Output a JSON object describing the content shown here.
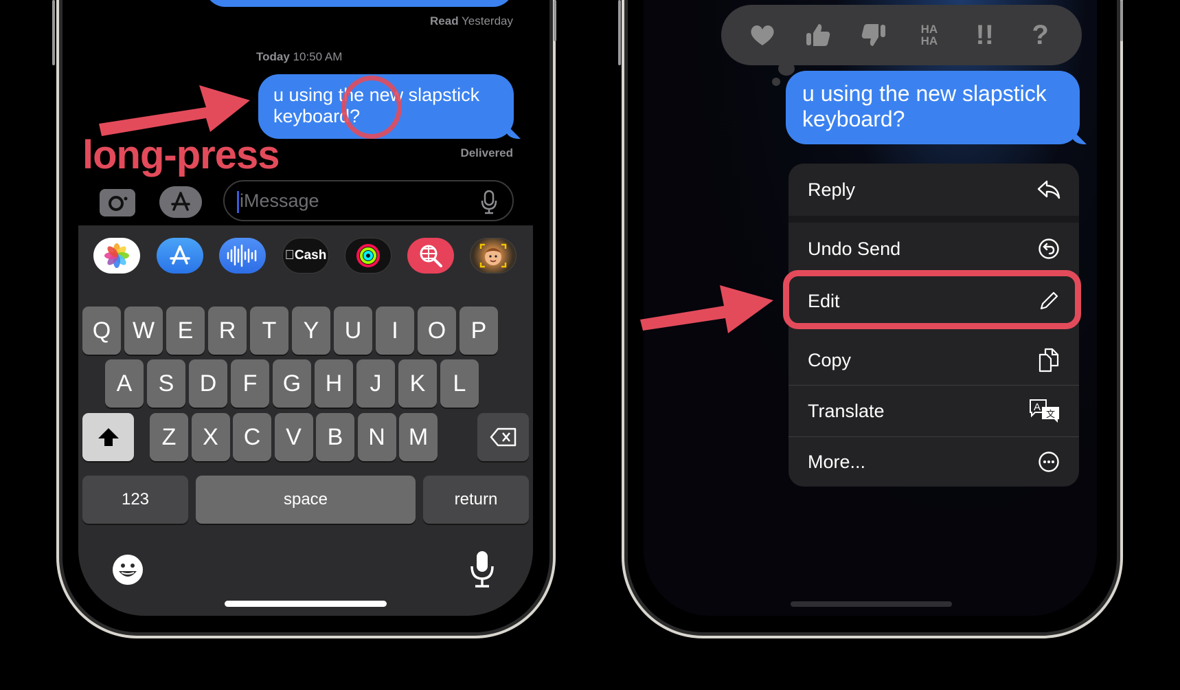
{
  "left_phone": {
    "previous_status": {
      "read_label": "Read",
      "read_time": "Yesterday"
    },
    "timestamp": {
      "day": "Today",
      "time": "10:50 AM"
    },
    "message": {
      "text": "u using the new slapstick keyboard?"
    },
    "delivery_status": "Delivered",
    "annotation": {
      "label": "long-press"
    },
    "composer": {
      "camera_icon": "camera-icon",
      "apps_icon": "app-store-icon",
      "placeholder": "iMessage",
      "mic_icon": "microphone-icon"
    },
    "app_drawer": [
      {
        "name": "Photos",
        "icon": "photos-icon"
      },
      {
        "name": "App Store",
        "icon": "app-store-icon"
      },
      {
        "name": "Audio Message",
        "icon": "waveform-icon"
      },
      {
        "name": "Cash",
        "label": "Cash",
        "icon": "apple-cash-icon"
      },
      {
        "name": "Activity",
        "icon": "activity-rings-icon"
      },
      {
        "name": "Images Search",
        "icon": "globe-search-icon"
      },
      {
        "name": "Memoji",
        "icon": "memoji-icon"
      }
    ],
    "keyboard": {
      "row1": [
        "Q",
        "W",
        "E",
        "R",
        "T",
        "Y",
        "U",
        "I",
        "O",
        "P"
      ],
      "row2": [
        "A",
        "S",
        "D",
        "F",
        "G",
        "H",
        "J",
        "K",
        "L"
      ],
      "row3": [
        "Z",
        "X",
        "C",
        "V",
        "B",
        "N",
        "M"
      ],
      "shift_icon": "shift-icon",
      "delete_icon": "delete-icon",
      "numbers_label": "123",
      "space_label": "space",
      "return_label": "return",
      "emoji_icon": "emoji-icon",
      "dictation_icon": "microphone-icon"
    }
  },
  "right_phone": {
    "tapbacks": [
      {
        "name": "heart",
        "icon": "heart-icon"
      },
      {
        "name": "thumbs-up",
        "icon": "thumbs-up-icon"
      },
      {
        "name": "thumbs-down",
        "icon": "thumbs-down-icon"
      },
      {
        "name": "haha",
        "label": "HA HA",
        "icon": "haha-icon"
      },
      {
        "name": "emphasize",
        "label": "!!",
        "icon": "double-exclamation-icon"
      },
      {
        "name": "question",
        "label": "?",
        "icon": "question-icon"
      }
    ],
    "message": {
      "text": "u using the new slapstick keyboard?"
    },
    "context_menu": [
      {
        "label": "Reply",
        "icon": "reply-arrow-icon"
      },
      {
        "label": "Undo Send",
        "icon": "undo-circle-icon"
      },
      {
        "label": "Edit",
        "icon": "pencil-icon",
        "highlighted": true
      },
      {
        "label": "Copy",
        "icon": "copy-documents-icon"
      },
      {
        "label": "Translate",
        "icon": "translate-icon"
      },
      {
        "label": "More...",
        "icon": "ellipsis-circle-icon"
      }
    ]
  },
  "colors": {
    "bubble_blue": "#3b82f0",
    "annotation_red": "#e34b5b",
    "menu_bg": "#232325",
    "keyboard_bg": "#2c2c2e"
  }
}
